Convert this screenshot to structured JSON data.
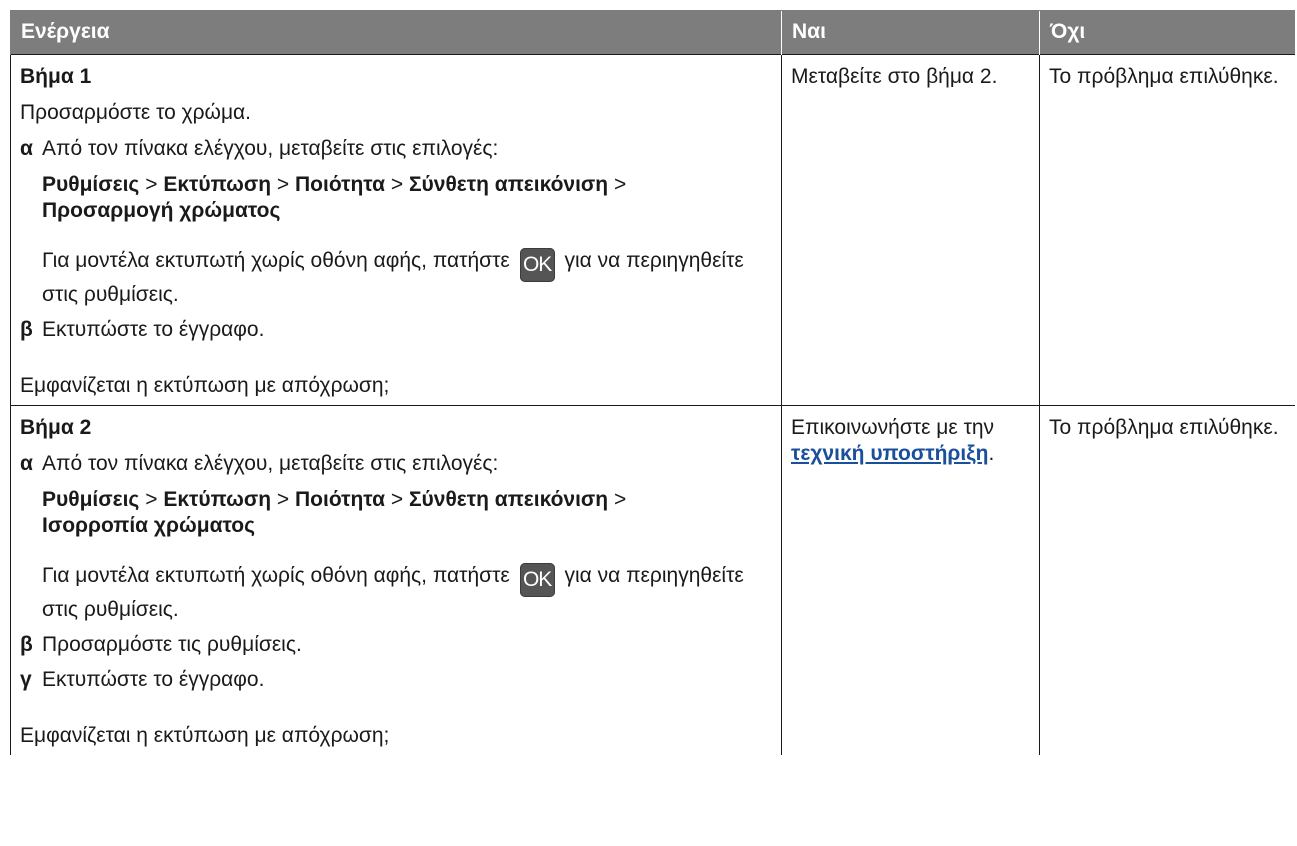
{
  "header": {
    "action": "Ενέργεια",
    "yes": "Ναι",
    "no": "Όχι"
  },
  "ok_key": "OK",
  "steps": [
    {
      "title": "Βήμα 1",
      "intro": "Προσαρμόστε το χρώμα.",
      "items": [
        {
          "letter": "α",
          "text": "Από τον πίνακα ελέγχου, μεταβείτε στις επιλογές:",
          "path": [
            "Ρυθμίσεις",
            ">",
            "Εκτύπωση",
            ">",
            "Ποιότητα",
            ">",
            "Σύνθετη απεικόνιση",
            ">",
            "Προσαρμογή χρώματος"
          ],
          "note_before": "Για μοντέλα εκτυπωτή χωρίς οθόνη αφής, πατήστε",
          "note_after": "για να περιηγηθείτε στις ρυθμίσεις."
        },
        {
          "letter": "β",
          "text": "Εκτυπώστε το έγγραφο."
        }
      ],
      "question": "Εμφανίζεται η εκτύπωση με απόχρωση;",
      "yes": "Μεταβείτε στο βήμα 2.",
      "no": "Το πρόβλημα επιλύθηκε."
    },
    {
      "title": "Βήμα 2",
      "items": [
        {
          "letter": "α",
          "text": "Από τον πίνακα ελέγχου, μεταβείτε στις επιλογές:",
          "path": [
            "Ρυθμίσεις",
            ">",
            "Εκτύπωση",
            ">",
            "Ποιότητα",
            ">",
            "Σύνθετη απεικόνιση",
            ">",
            "Ισορροπία χρώματος"
          ],
          "note_before": "Για μοντέλα εκτυπωτή χωρίς οθόνη αφής, πατήστε",
          "note_after": "για να περιηγηθείτε στις ρυθμίσεις."
        },
        {
          "letter": "β",
          "text": "Προσαρμόστε τις ρυθμίσεις."
        },
        {
          "letter": "γ",
          "text": "Εκτυπώστε το έγγραφο."
        }
      ],
      "question": "Εμφανίζεται η εκτύπωση με απόχρωση;",
      "yes_prefix": "Επικοινωνήστε με την",
      "yes_link": "τεχνική υποστήριξη",
      "yes_suffix": ".",
      "no": "Το πρόβλημα επιλύθηκε."
    }
  ]
}
